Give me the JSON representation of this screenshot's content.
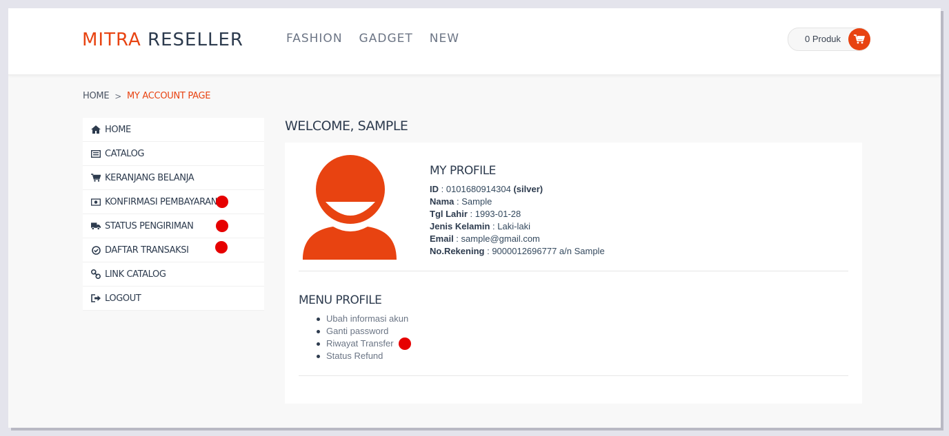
{
  "header": {
    "brand_part1": "MITRA",
    "brand_part2": "RESELLER",
    "nav": [
      "FASHION",
      "GADGET",
      "NEW"
    ],
    "cart_label": "0 Produk"
  },
  "breadcrumb": {
    "home": "HOME",
    "separator": ">",
    "current": "MY ACCOUNT PAGE"
  },
  "sidebar": {
    "items": [
      {
        "label": "HOME",
        "icon": "home-icon"
      },
      {
        "label": "CATALOG",
        "icon": "list-icon"
      },
      {
        "label": "KERANJANG BELANJA",
        "icon": "cart-icon"
      },
      {
        "label": "KONFIRMASI PEMBAYARAN",
        "icon": "money-icon"
      },
      {
        "label": "STATUS PENGIRIMAN",
        "icon": "truck-icon"
      },
      {
        "label": "DAFTAR TRANSAKSI",
        "icon": "check-circle-icon"
      },
      {
        "label": "LINK CATALOG",
        "icon": "link-icon"
      },
      {
        "label": "LOGOUT",
        "icon": "sign-out-icon"
      }
    ]
  },
  "main": {
    "welcome": "WELCOME, SAMPLE",
    "profile": {
      "title": "MY PROFILE",
      "id_label": "ID",
      "id_value": "0101680914304",
      "id_tier": "(silver)",
      "nama_label": "Nama",
      "nama_value": "Sample",
      "tgl_label": "Tgl Lahir",
      "tgl_value": "1993-01-28",
      "jk_label": "Jenis Kelamin",
      "jk_value": "Laki-laki",
      "email_label": "Email",
      "email_value": "sample@gmail.com",
      "rek_label": "No.Rekening",
      "rek_value": "9000012696777 a/n Sample"
    },
    "menu_profile": {
      "title": "MENU PROFILE",
      "items": [
        "Ubah informasi akun",
        "Ganti password",
        "Riwayat Transfer",
        "Status Refund"
      ]
    }
  },
  "colors": {
    "accent": "#e84311",
    "text_dark": "#2d3b4e",
    "marker_red": "#e60000"
  }
}
